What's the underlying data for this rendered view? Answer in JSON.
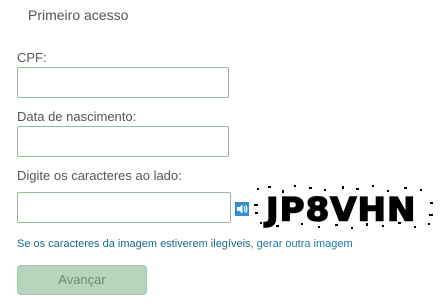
{
  "form": {
    "title": "Primeiro acesso",
    "cpf": {
      "label": "CPF:",
      "value": "",
      "placeholder": ""
    },
    "birth_date": {
      "label": "Data de nascimento:",
      "value": "",
      "placeholder": ""
    },
    "captcha": {
      "label": "Digite os caracteres ao lado:",
      "value": "",
      "placeholder": "",
      "image_text": "JP8VHN",
      "audio_icon": "speaker-icon",
      "help_prefix": "Se os caracteres da imagem estiverem ilegíveis,",
      "help_link": "gerar outra imagem"
    },
    "submit_label": "Avançar"
  },
  "colors": {
    "input_border": "#9bb89b",
    "button_bg": "#b7d5bb",
    "button_text": "#6a8a6e",
    "link": "#1f78a8",
    "audio_icon": "#2f8fd0"
  }
}
